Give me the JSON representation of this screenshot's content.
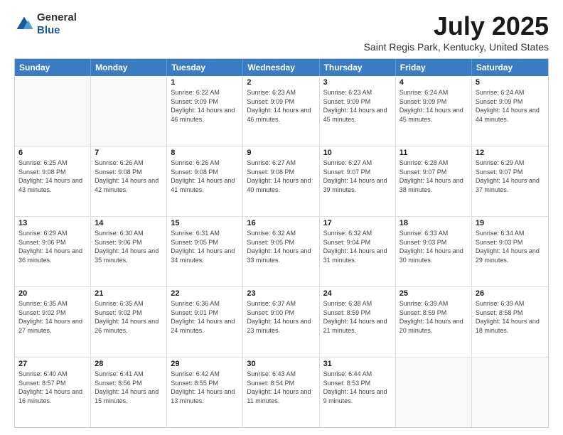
{
  "header": {
    "logo_general": "General",
    "logo_blue": "Blue",
    "main_title": "July 2025",
    "subtitle": "Saint Regis Park, Kentucky, United States"
  },
  "calendar": {
    "days": [
      "Sunday",
      "Monday",
      "Tuesday",
      "Wednesday",
      "Thursday",
      "Friday",
      "Saturday"
    ],
    "rows": [
      [
        {
          "day": "",
          "info": ""
        },
        {
          "day": "",
          "info": ""
        },
        {
          "day": "1",
          "info": "Sunrise: 6:22 AM\nSunset: 9:09 PM\nDaylight: 14 hours and 46 minutes."
        },
        {
          "day": "2",
          "info": "Sunrise: 6:23 AM\nSunset: 9:09 PM\nDaylight: 14 hours and 46 minutes."
        },
        {
          "day": "3",
          "info": "Sunrise: 6:23 AM\nSunset: 9:09 PM\nDaylight: 14 hours and 45 minutes."
        },
        {
          "day": "4",
          "info": "Sunrise: 6:24 AM\nSunset: 9:09 PM\nDaylight: 14 hours and 45 minutes."
        },
        {
          "day": "5",
          "info": "Sunrise: 6:24 AM\nSunset: 9:09 PM\nDaylight: 14 hours and 44 minutes."
        }
      ],
      [
        {
          "day": "6",
          "info": "Sunrise: 6:25 AM\nSunset: 9:08 PM\nDaylight: 14 hours and 43 minutes."
        },
        {
          "day": "7",
          "info": "Sunrise: 6:26 AM\nSunset: 9:08 PM\nDaylight: 14 hours and 42 minutes."
        },
        {
          "day": "8",
          "info": "Sunrise: 6:26 AM\nSunset: 9:08 PM\nDaylight: 14 hours and 41 minutes."
        },
        {
          "day": "9",
          "info": "Sunrise: 6:27 AM\nSunset: 9:08 PM\nDaylight: 14 hours and 40 minutes."
        },
        {
          "day": "10",
          "info": "Sunrise: 6:27 AM\nSunset: 9:07 PM\nDaylight: 14 hours and 39 minutes."
        },
        {
          "day": "11",
          "info": "Sunrise: 6:28 AM\nSunset: 9:07 PM\nDaylight: 14 hours and 38 minutes."
        },
        {
          "day": "12",
          "info": "Sunrise: 6:29 AM\nSunset: 9:07 PM\nDaylight: 14 hours and 37 minutes."
        }
      ],
      [
        {
          "day": "13",
          "info": "Sunrise: 6:29 AM\nSunset: 9:06 PM\nDaylight: 14 hours and 36 minutes."
        },
        {
          "day": "14",
          "info": "Sunrise: 6:30 AM\nSunset: 9:06 PM\nDaylight: 14 hours and 35 minutes."
        },
        {
          "day": "15",
          "info": "Sunrise: 6:31 AM\nSunset: 9:05 PM\nDaylight: 14 hours and 34 minutes."
        },
        {
          "day": "16",
          "info": "Sunrise: 6:32 AM\nSunset: 9:05 PM\nDaylight: 14 hours and 33 minutes."
        },
        {
          "day": "17",
          "info": "Sunrise: 6:32 AM\nSunset: 9:04 PM\nDaylight: 14 hours and 31 minutes."
        },
        {
          "day": "18",
          "info": "Sunrise: 6:33 AM\nSunset: 9:03 PM\nDaylight: 14 hours and 30 minutes."
        },
        {
          "day": "19",
          "info": "Sunrise: 6:34 AM\nSunset: 9:03 PM\nDaylight: 14 hours and 29 minutes."
        }
      ],
      [
        {
          "day": "20",
          "info": "Sunrise: 6:35 AM\nSunset: 9:02 PM\nDaylight: 14 hours and 27 minutes."
        },
        {
          "day": "21",
          "info": "Sunrise: 6:35 AM\nSunset: 9:02 PM\nDaylight: 14 hours and 26 minutes."
        },
        {
          "day": "22",
          "info": "Sunrise: 6:36 AM\nSunset: 9:01 PM\nDaylight: 14 hours and 24 minutes."
        },
        {
          "day": "23",
          "info": "Sunrise: 6:37 AM\nSunset: 9:00 PM\nDaylight: 14 hours and 23 minutes."
        },
        {
          "day": "24",
          "info": "Sunrise: 6:38 AM\nSunset: 8:59 PM\nDaylight: 14 hours and 21 minutes."
        },
        {
          "day": "25",
          "info": "Sunrise: 6:39 AM\nSunset: 8:59 PM\nDaylight: 14 hours and 20 minutes."
        },
        {
          "day": "26",
          "info": "Sunrise: 6:39 AM\nSunset: 8:58 PM\nDaylight: 14 hours and 18 minutes."
        }
      ],
      [
        {
          "day": "27",
          "info": "Sunrise: 6:40 AM\nSunset: 8:57 PM\nDaylight: 14 hours and 16 minutes."
        },
        {
          "day": "28",
          "info": "Sunrise: 6:41 AM\nSunset: 8:56 PM\nDaylight: 14 hours and 15 minutes."
        },
        {
          "day": "29",
          "info": "Sunrise: 6:42 AM\nSunset: 8:55 PM\nDaylight: 14 hours and 13 minutes."
        },
        {
          "day": "30",
          "info": "Sunrise: 6:43 AM\nSunset: 8:54 PM\nDaylight: 14 hours and 11 minutes."
        },
        {
          "day": "31",
          "info": "Sunrise: 6:44 AM\nSunset: 8:53 PM\nDaylight: 14 hours and 9 minutes."
        },
        {
          "day": "",
          "info": ""
        },
        {
          "day": "",
          "info": ""
        }
      ]
    ]
  }
}
